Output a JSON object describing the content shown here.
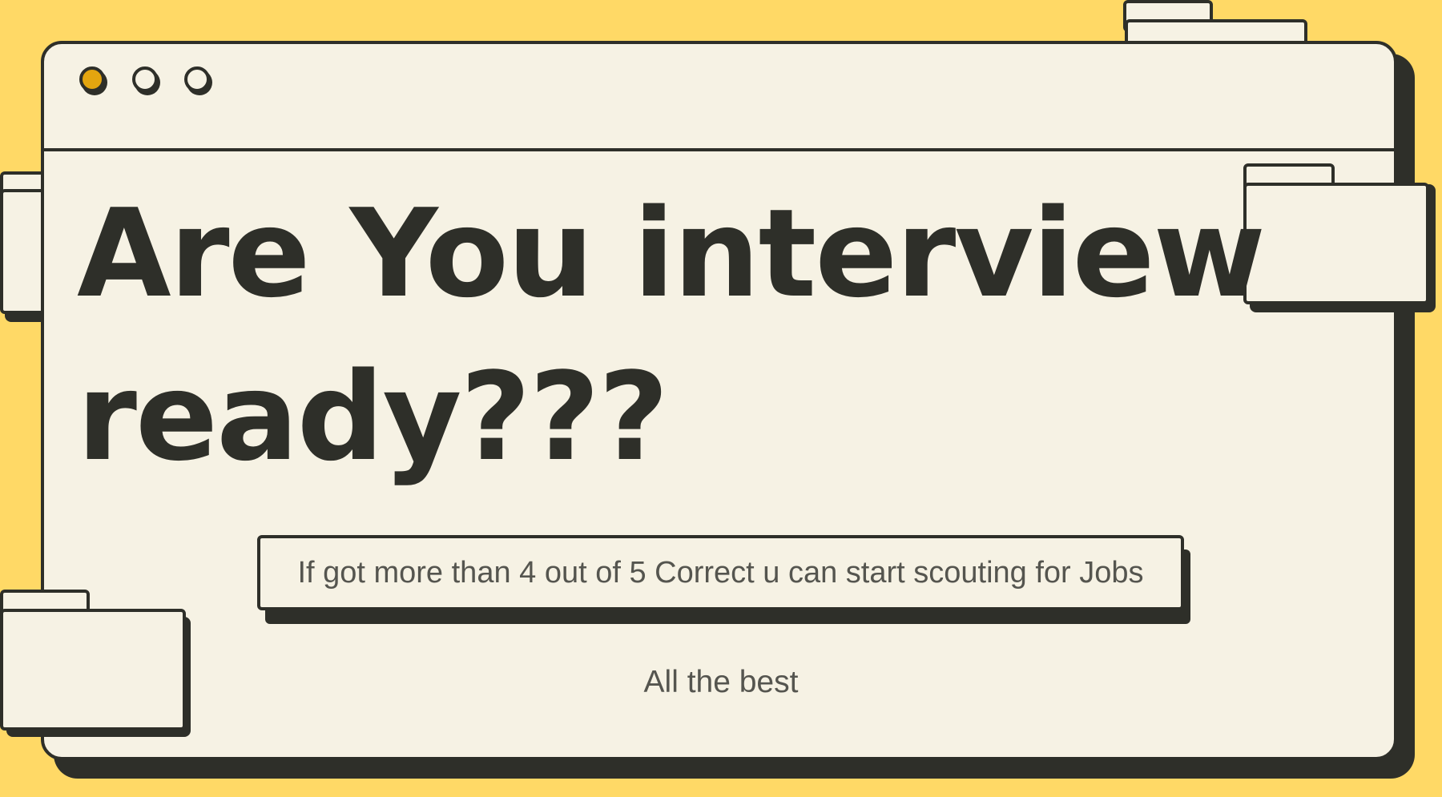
{
  "window": {
    "title_dots": [
      "close",
      "minimize",
      "maximize"
    ],
    "accent_color": "#E3A50F",
    "background_color": "#FFD966",
    "panel_color": "#F6F2E4",
    "outline_color": "#2E2F29"
  },
  "headline": {
    "line1": "Are You interview",
    "line2": "ready???"
  },
  "note": {
    "text": "If got more than 4 out of 5 Correct u can start scouting for Jobs"
  },
  "footer": {
    "text": "All the best"
  }
}
